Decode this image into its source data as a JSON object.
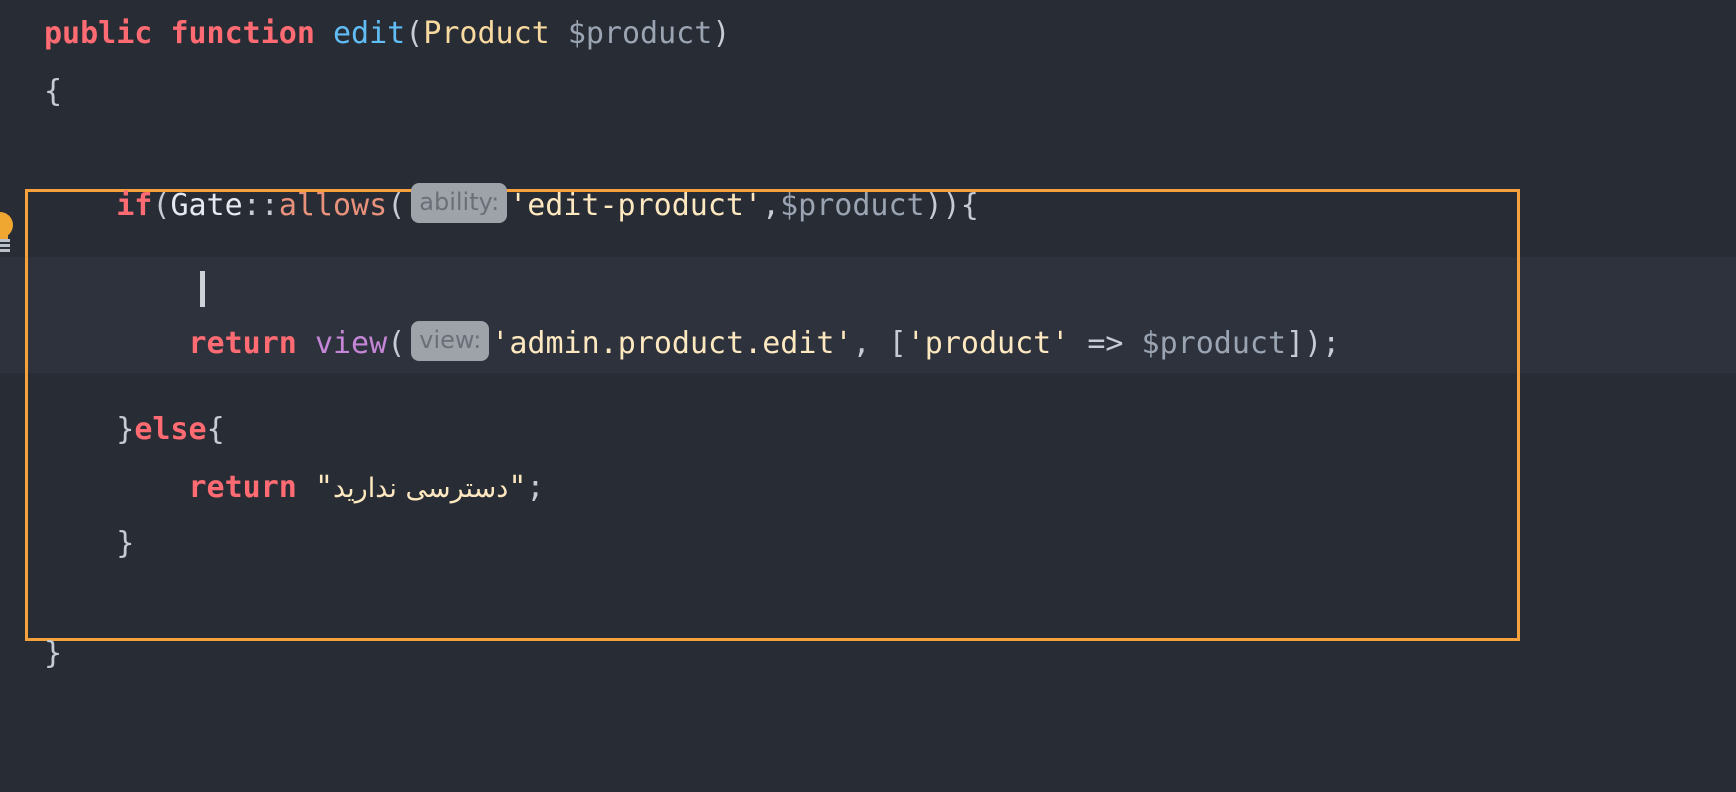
{
  "editor": {
    "language": "php",
    "theme": "One Dark",
    "background_color": "#282c34",
    "current_line_color": "#2d323c",
    "scope_highlight_color": "#f6a13c",
    "caret_color": "#cdd2d8",
    "gutter_icon": "lightbulb-intention-icon"
  },
  "code": {
    "line1": {
      "kw_public": "public",
      "kw_function": "function",
      "name": "edit",
      "paren_open": "(",
      "type": "Product",
      "space": " ",
      "param": "$product",
      "paren_close": ")"
    },
    "line2": {
      "brace": "{"
    },
    "line3": {
      "indent": "    ",
      "kw_if": "if",
      "paren_open": "(",
      "class": "Gate",
      "scope_op": "::",
      "method": "allows",
      "call_open": "(",
      "hint": "ability:",
      "arg1": "'edit-product'",
      "comma": ",",
      "arg2": "$product",
      "close": "))",
      "brace": "{"
    },
    "line4": {
      "indent": "        ",
      "content": ""
    },
    "line5": {
      "indent": "        ",
      "kw_return": "return",
      "helper": "view",
      "call_open": "(",
      "hint": "view:",
      "arg1": "'admin.product.edit'",
      "comma": ", ",
      "bracket_open": "[",
      "key": "'product'",
      "arrow": " => ",
      "value": "$product",
      "bracket_close": "]",
      "call_close": ")",
      "semicolon": ";"
    },
    "line6": {
      "content": ""
    },
    "line7": {
      "indent": "    ",
      "brace_close": "}",
      "kw_else": "else",
      "brace_open": "{"
    },
    "line8": {
      "indent": "        ",
      "kw_return": "return",
      "quote_open": "\"",
      "message": "دسترسی ندارید",
      "quote_close": "\"",
      "semicolon": ";"
    },
    "line9": {
      "indent": "    ",
      "brace_close": "}"
    },
    "line10": {
      "brace_close": "}"
    }
  }
}
